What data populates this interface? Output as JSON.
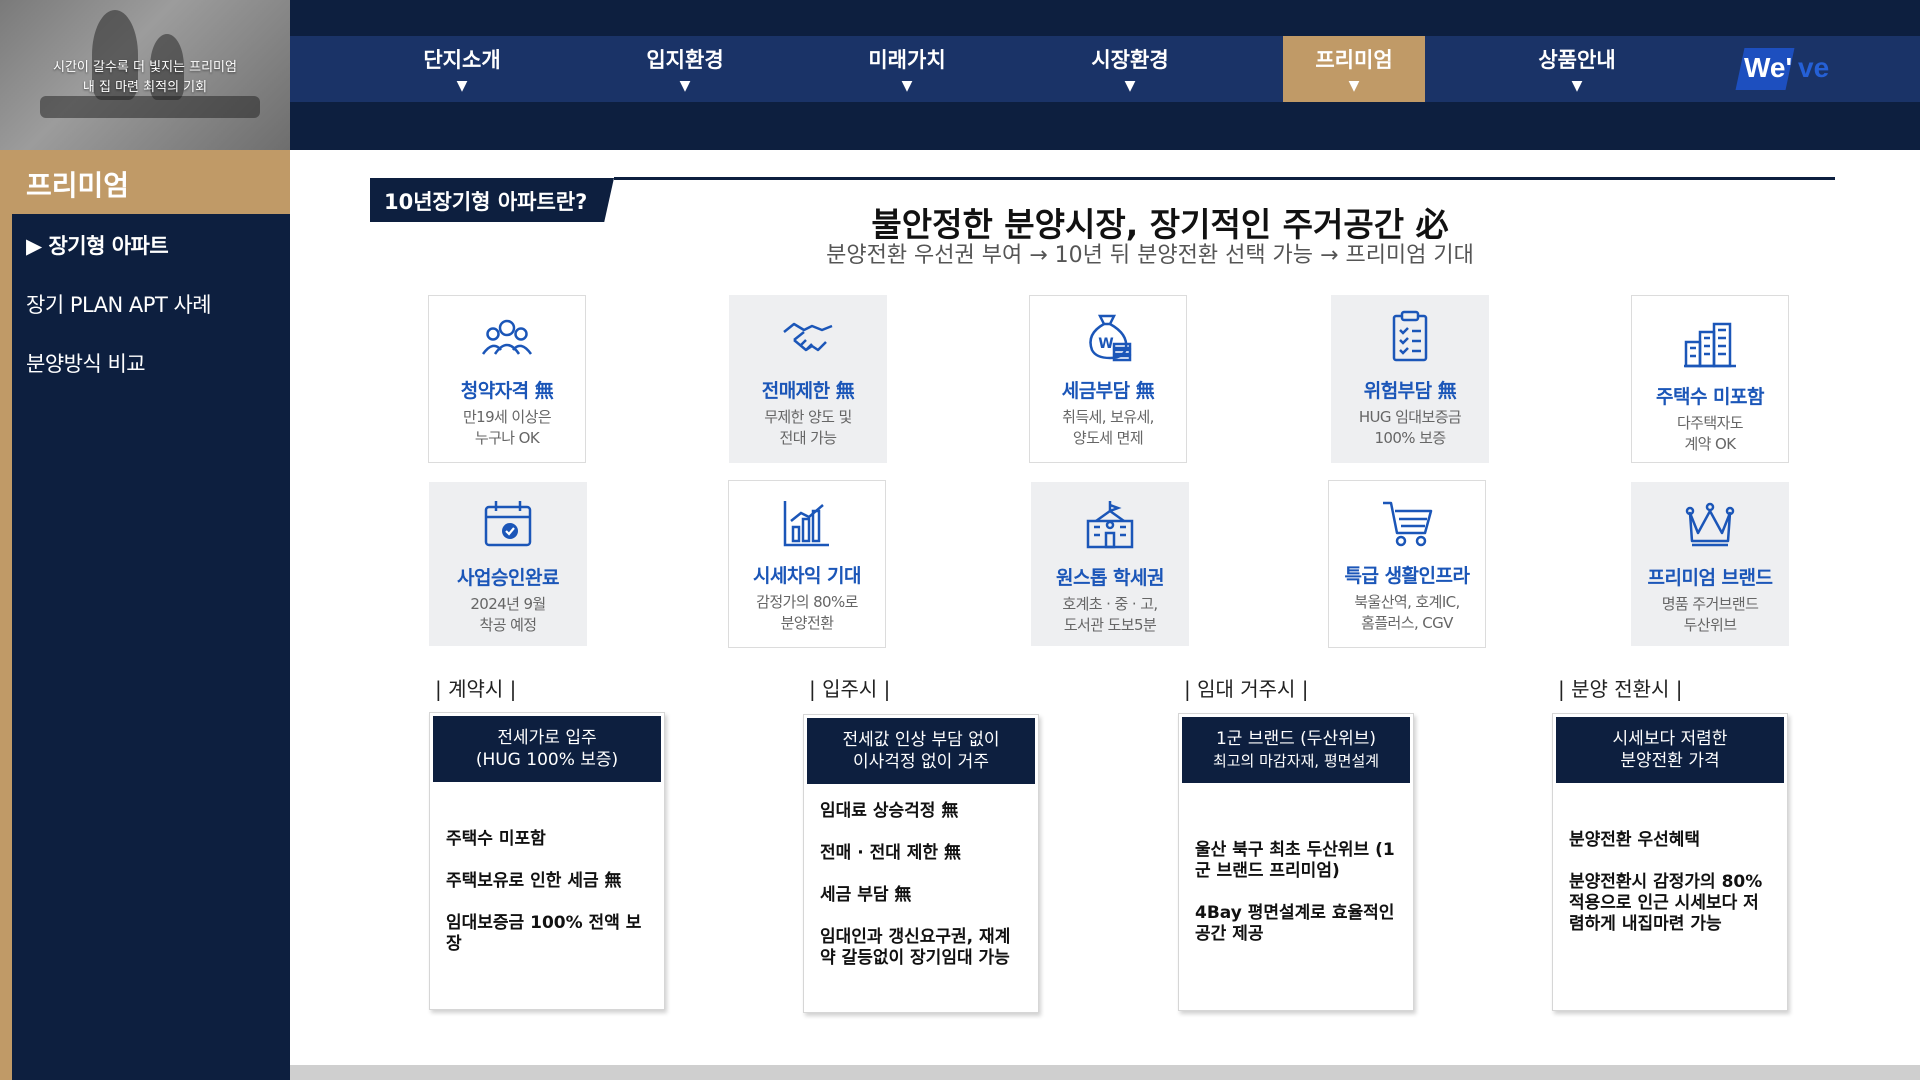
{
  "hero": {
    "caption_line1": "시간이 갈수록 더 빛지는 프리미엄",
    "caption_line2": "내 집 마련 최적의 기회"
  },
  "sidebar": {
    "title": "프리미엄",
    "items": [
      {
        "label": "▶ 장기형 아파트"
      },
      {
        "label": "장기 PLAN APT 사례"
      },
      {
        "label": "분양방식 비교"
      }
    ]
  },
  "nav": {
    "items": [
      {
        "label": "단지소개"
      },
      {
        "label": "입지환경"
      },
      {
        "label": "미래가치"
      },
      {
        "label": "시장환경"
      },
      {
        "label": "프리미엄"
      },
      {
        "label": "상품안내"
      }
    ],
    "active_index": 4,
    "logo_text": "We'",
    "logo_text2": "ve"
  },
  "content": {
    "tag": "10년장기형 아파트란?",
    "headline": "불안정한 분양시장, 장기적인 주거공간 必",
    "subline": "분양전환 우선권 부여 → 10년 뒤 분양전환 선택 가능 → 프리미엄 기대",
    "cards": [
      {
        "icon": "people-icon",
        "title": "청약자격 無",
        "line1": "만19세 이상은",
        "line2": "누구나 OK"
      },
      {
        "icon": "handshake-icon",
        "title": "전매제한 無",
        "line1": "무제한 양도 및",
        "line2": "전대 가능"
      },
      {
        "icon": "money-bag-icon",
        "title": "세금부담 無",
        "line1": "취득세, 보유세,",
        "line2": "양도세 면제"
      },
      {
        "icon": "checklist-icon",
        "title": "위험부담 無",
        "line1": "HUG 임대보증금",
        "line2": "100% 보증"
      },
      {
        "icon": "buildings-icon",
        "title": "주택수 미포함",
        "line1": "다주택자도",
        "line2": "계약 OK"
      },
      {
        "icon": "calendar-check-icon",
        "title": "사업승인완료",
        "line1": "2024년 9월",
        "line2": "착공 예정"
      },
      {
        "icon": "bar-chart-icon",
        "title": "시세차익 기대",
        "line1": "감정가의 80%로",
        "line2": "분양전환"
      },
      {
        "icon": "school-icon",
        "title": "원스톱 학세권",
        "line1": "호계초 · 중 · 고,",
        "line2": "도서관 도보5분"
      },
      {
        "icon": "cart-icon",
        "title": "특급 생활인프라",
        "line1": "북울산역, 호계IC,",
        "line2": "홈플러스, CGV"
      },
      {
        "icon": "crown-icon",
        "title": "프리미엄 브랜드",
        "line1": "명품 주거브랜드",
        "line2": "두산위브"
      }
    ],
    "stages": [
      {
        "label": "| 계약시 |",
        "head1": "전세가로 입주",
        "head2": "(HUG 100% 보증)",
        "body": [
          "주택수 미포함",
          "주택보유로 인한 세금 無",
          "임대보증금 100% 전액 보장"
        ]
      },
      {
        "label": "| 입주시 |",
        "head1": "전세값 인상 부담 없이",
        "head2": "이사걱정 없이 거주",
        "body": [
          "임대료 상승걱정 無",
          "전매 · 전대 제한 無",
          "세금 부담 無",
          "임대인과 갱신요구권, 재계약 갈등없이 장기임대 가능"
        ]
      },
      {
        "label": "| 임대 거주시 |",
        "head1": "1군 브랜드 (두산위브)",
        "head2": "최고의 마감자재, 평면설계",
        "body": [
          "울산 북구 최초 두산위브 (1군 브랜드 프리미엄)",
          "4Bay 평면설계로 효율적인 공간 제공"
        ]
      },
      {
        "label": "| 분양 전환시 |",
        "head1": "시세보다 저렴한",
        "head2": "분양전환 가격",
        "body": [
          "분양전환 우선혜택",
          "분양전환시 감정가의 80%적용으로 인근 시세보다 저렴하게 내집마련 가능"
        ]
      }
    ]
  },
  "colors": {
    "navy": "#0d1f3f",
    "nav_blue": "#1a3367",
    "gold": "#c09a67",
    "accent_blue": "#1b56b8"
  }
}
